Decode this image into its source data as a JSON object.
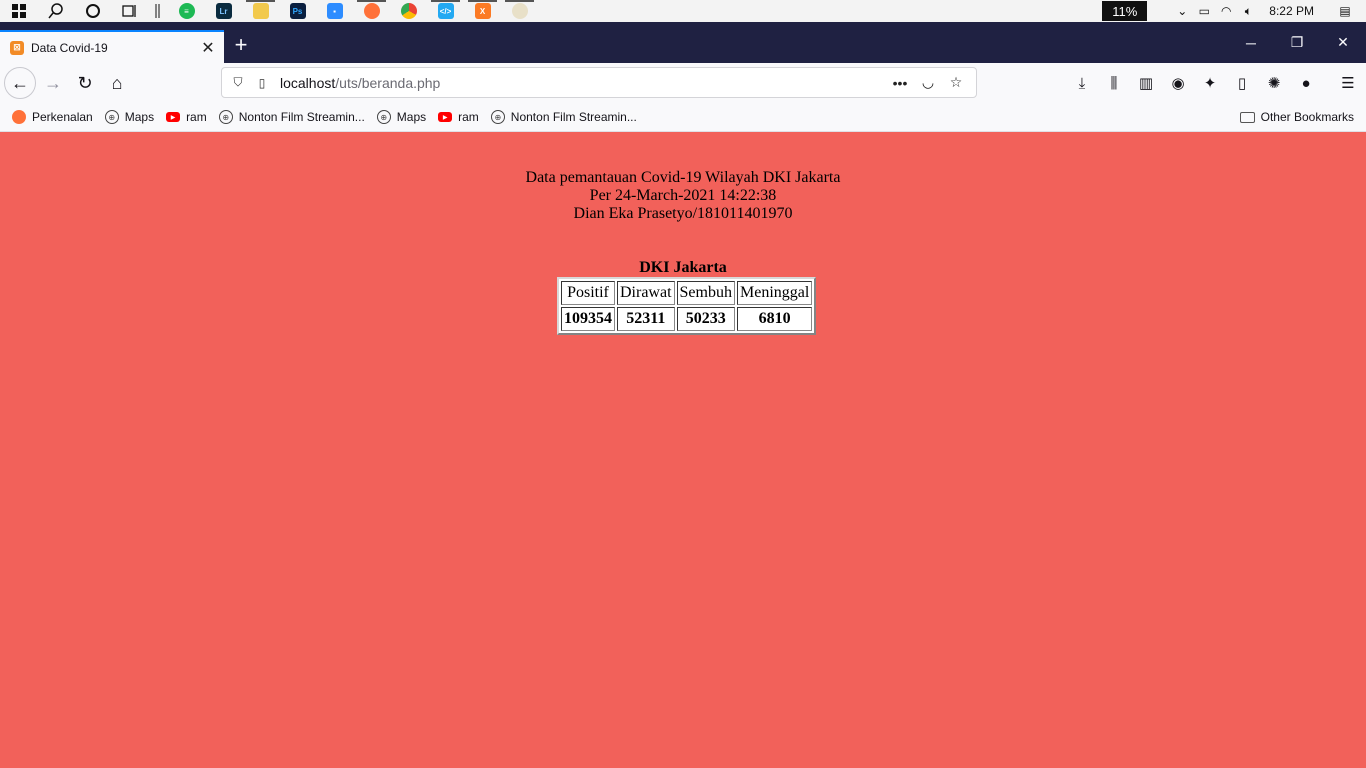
{
  "taskbar": {
    "battery": "11%",
    "clock": "8:22 PM"
  },
  "browser": {
    "tab_title": "Data Covid-19",
    "url_host": "localhost",
    "url_path": "/uts/beranda.php"
  },
  "bookmarks": {
    "items": [
      {
        "label": "Perkenalan",
        "icon": "firefox-icon"
      },
      {
        "label": "Maps",
        "icon": "globe-icon"
      },
      {
        "label": "ram",
        "icon": "youtube-icon"
      },
      {
        "label": "Nonton Film Streamin...",
        "icon": "globe-icon"
      },
      {
        "label": "Maps",
        "icon": "globe-icon"
      },
      {
        "label": "ram",
        "icon": "youtube-icon"
      },
      {
        "label": "Nonton Film Streamin...",
        "icon": "globe-icon"
      }
    ],
    "other": "Other Bookmarks"
  },
  "page": {
    "line1": "Data pemantauan Covid-19 Wilayah DKI Jakarta",
    "line2": "Per 24-March-2021 14:22:38",
    "line3": "Dian Eka Prasetyo/181011401970",
    "region": "DKI Jakarta",
    "table": {
      "headers": [
        "Positif",
        "Dirawat",
        "Sembuh",
        "Meninggal"
      ],
      "values": [
        "109354",
        "52311",
        "50233",
        "6810"
      ]
    },
    "background_color": "#f2615a"
  }
}
